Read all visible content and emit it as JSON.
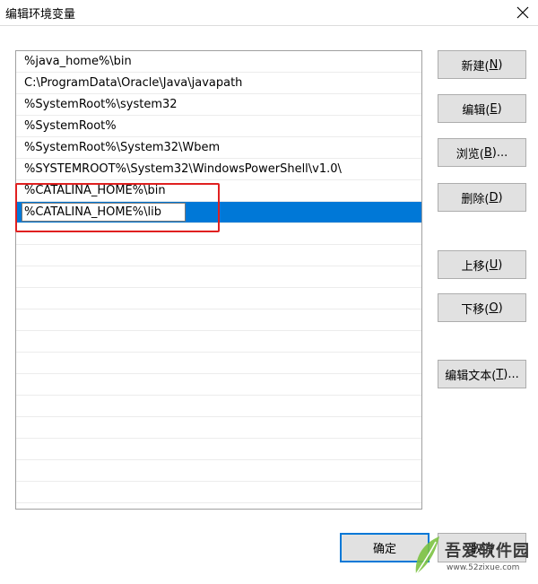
{
  "window": {
    "title": "编辑环境变量",
    "close_icon": "close-icon"
  },
  "list": {
    "items": [
      "%java_home%\\bin",
      "C:\\ProgramData\\Oracle\\Java\\javapath",
      "%SystemRoot%\\system32",
      "%SystemRoot%",
      "%SystemRoot%\\System32\\Wbem",
      "%SYSTEMROOT%\\System32\\WindowsPowerShell\\v1.0\\",
      "%CATALINA_HOME%\\bin"
    ],
    "editing_value": "%CATALINA_HOME%\\lib",
    "selection_color": "#0078d7",
    "highlight_color": "#e02020"
  },
  "buttons": {
    "new": {
      "text": "新建(",
      "key": "N",
      "end": ")"
    },
    "edit": {
      "text": "编辑(",
      "key": "E",
      "end": ")"
    },
    "browse": {
      "text": "浏览(",
      "key": "B",
      "end": ")..."
    },
    "delete": {
      "text": "删除(",
      "key": "D",
      "end": ")"
    },
    "move_up": {
      "text": "上移(",
      "key": "U",
      "end": ")"
    },
    "move_down": {
      "text": "下移(",
      "key": "O",
      "end": ")"
    },
    "edit_text": {
      "text": "编辑文本(",
      "key": "T",
      "end": ")..."
    },
    "ok": "确定",
    "cancel": "取消"
  },
  "watermark": {
    "line1": "吾爱软件园",
    "line2": "www.52zixue.com"
  }
}
